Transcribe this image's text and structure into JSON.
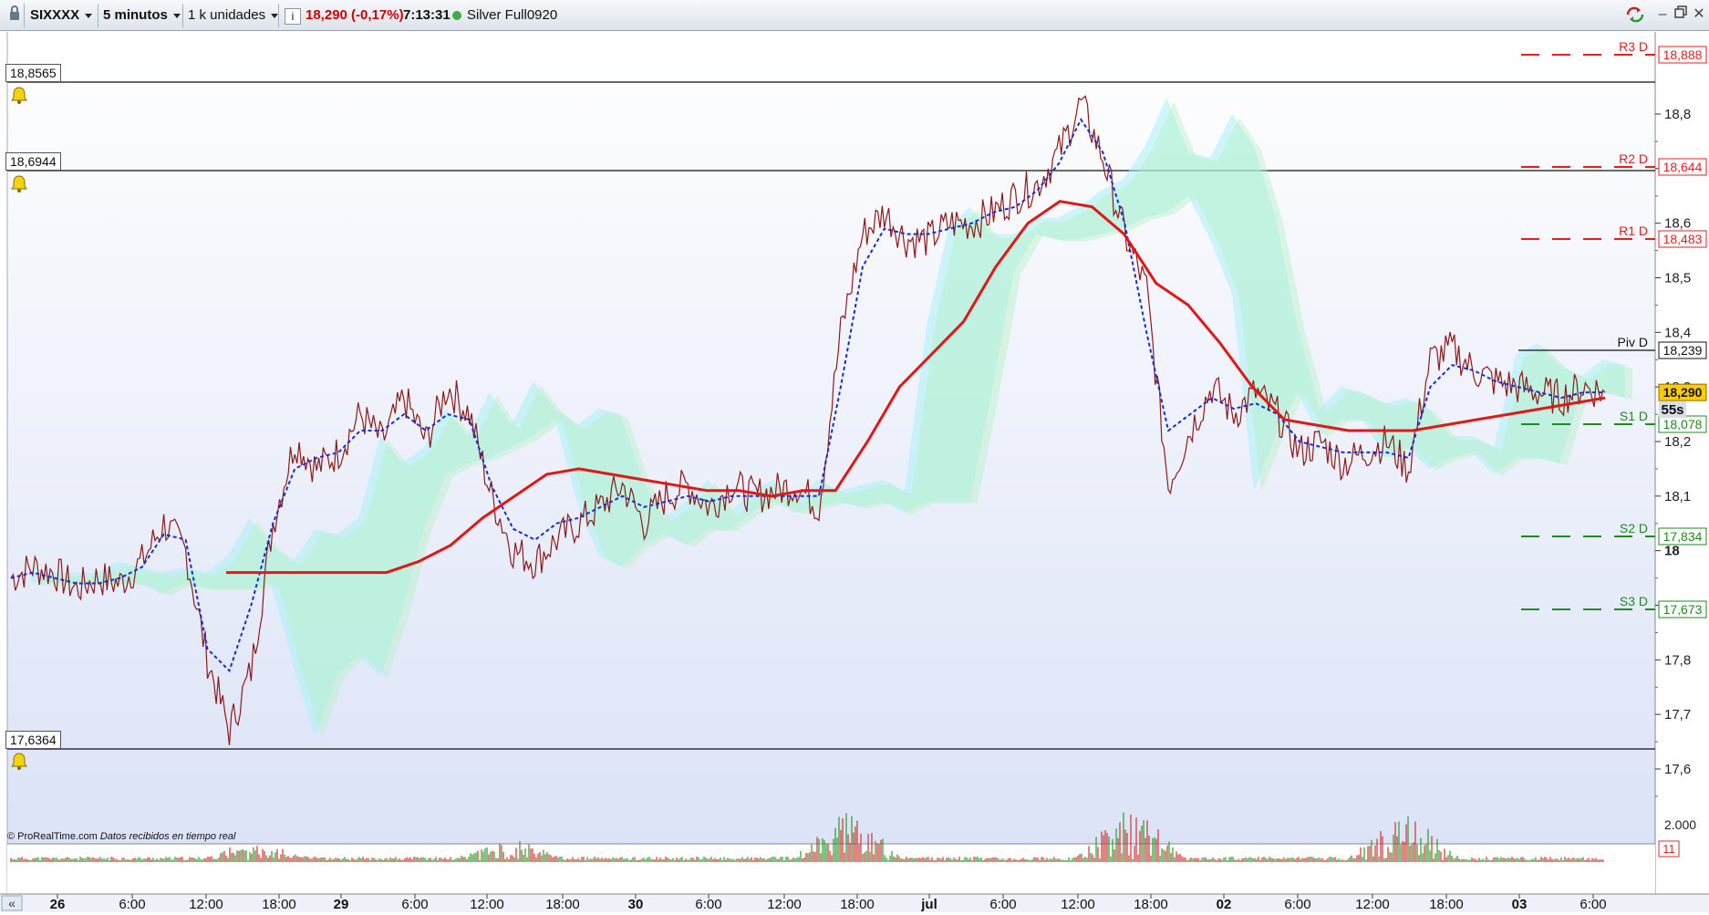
{
  "toolbar": {
    "symbol": "SIXXXX",
    "interval": "5 minutos",
    "units": "1 k unidades",
    "info_icon_label": "i",
    "price_change": "18,290 (-0,17%)",
    "time": "7:13:31",
    "feed": "Silver Full0920",
    "icons": [
      "lock-icon",
      "info-icon",
      "status-dot-icon",
      "refresh-icon",
      "minimize-icon",
      "restore-icon",
      "close-icon"
    ],
    "colors": {
      "price_change": "#cc0000",
      "status_dot": "#3cb043"
    }
  },
  "alert_levels": [
    {
      "label": "18,8565",
      "value": 18.8565
    },
    {
      "label": "18,6944",
      "value": 18.6944
    },
    {
      "label": "17,6364",
      "value": 17.6364
    }
  ],
  "pivots": [
    {
      "name": "R3 D",
      "value_label": "18,888",
      "value": 18.888,
      "color": "#e02020"
    },
    {
      "name": "R2 D",
      "value_label": "18,644",
      "value": 18.644,
      "color": "#e02020"
    },
    {
      "name": "R1 D",
      "value_label": "18,483",
      "value": 18.483,
      "color": "#e02020"
    },
    {
      "name": "Piv D",
      "value_label": "18,239",
      "value": 18.239,
      "color": "#111111"
    },
    {
      "name": "S1 D",
      "value_label": "18,078",
      "value": 18.078,
      "color": "#1f8a1f"
    },
    {
      "name": "S2 D",
      "value_label": "17,834",
      "value": 17.834,
      "color": "#1f8a1f"
    },
    {
      "name": "S3 D",
      "value_label": "17,673",
      "value": 17.673,
      "color": "#1f8a1f"
    }
  ],
  "current_price": {
    "label": "18,290",
    "value": 18.29,
    "countdown": "55s",
    "color": "#ffcc00"
  },
  "credit": {
    "brand": "© ProRealTime.com",
    "note": "Datos recibidos en tiempo real"
  },
  "volume_axis": {
    "label": "2.000",
    "current": "11"
  },
  "nav_button": "«",
  "chart_data": {
    "type": "line",
    "title": "",
    "ylim": [
      17.5,
      18.9
    ],
    "y_ticks": [
      "18,8",
      "18,7",
      "18,6",
      "18,5",
      "18,4",
      "18,3",
      "18,2",
      "18,1",
      "18",
      "17,9",
      "17,8",
      "17,7",
      "17,6"
    ],
    "y_tick_values": [
      18.8,
      18.7,
      18.6,
      18.5,
      18.4,
      18.3,
      18.2,
      18.1,
      18.0,
      17.9,
      17.8,
      17.7,
      17.6
    ],
    "x_ticks": [
      {
        "label": "26",
        "bold": true
      },
      {
        "label": "6:00"
      },
      {
        "label": "12:00"
      },
      {
        "label": "18:00"
      },
      {
        "label": "29",
        "bold": true
      },
      {
        "label": "6:00"
      },
      {
        "label": "12:00"
      },
      {
        "label": "18:00"
      },
      {
        "label": "30",
        "bold": true
      },
      {
        "label": "6:00"
      },
      {
        "label": "12:00"
      },
      {
        "label": "18:00"
      },
      {
        "label": "jul",
        "bold": true
      },
      {
        "label": "6:00"
      },
      {
        "label": "12:00"
      },
      {
        "label": "18:00"
      },
      {
        "label": "02",
        "bold": true
      },
      {
        "label": "6:00"
      },
      {
        "label": "12:00"
      },
      {
        "label": "18:00"
      },
      {
        "label": "03",
        "bold": true
      },
      {
        "label": "6:00"
      }
    ],
    "series": [
      {
        "kind": "price",
        "color": "#8b1a1a",
        "values": [
          17.95,
          17.97,
          17.96,
          17.93,
          17.95,
          17.94,
          17.98,
          18.05,
          18.0,
          17.8,
          17.67,
          17.78,
          18.05,
          18.2,
          18.15,
          18.18,
          18.25,
          18.2,
          18.28,
          18.2,
          18.3,
          18.25,
          18.1,
          18.0,
          17.98,
          18.02,
          18.05,
          18.08,
          18.12,
          18.05,
          18.1,
          18.12,
          18.08,
          18.12,
          18.1,
          18.11,
          18.12,
          18.08,
          18.4,
          18.58,
          18.62,
          18.57,
          18.57,
          18.6,
          18.6,
          18.62,
          18.65,
          18.67,
          18.73,
          18.82,
          18.72,
          18.58,
          18.48,
          18.12,
          18.22,
          18.3,
          18.25,
          18.29,
          18.25,
          18.18,
          18.2,
          18.16,
          18.18,
          18.2,
          18.15,
          18.35,
          18.37,
          18.33,
          18.31,
          18.3,
          18.29,
          18.28,
          18.3,
          18.29
        ]
      },
      {
        "kind": "tenkan",
        "color": "#1a2bd0",
        "values": [
          17.95,
          17.96,
          17.95,
          17.94,
          17.94,
          17.95,
          17.97,
          18.03,
          18.02,
          17.82,
          17.78,
          17.9,
          18.05,
          18.15,
          18.17,
          18.18,
          18.22,
          18.22,
          18.25,
          18.22,
          18.25,
          18.24,
          18.12,
          18.04,
          18.02,
          18.05,
          18.06,
          18.08,
          18.1,
          18.08,
          18.09,
          18.1,
          18.09,
          18.1,
          18.1,
          18.1,
          18.1,
          18.1,
          18.3,
          18.52,
          18.59,
          18.58,
          18.58,
          18.59,
          18.6,
          18.62,
          18.63,
          18.66,
          18.71,
          18.79,
          18.73,
          18.6,
          18.4,
          18.22,
          18.25,
          18.28,
          18.26,
          18.27,
          18.25,
          18.2,
          18.19,
          18.18,
          18.18,
          18.18,
          18.17,
          18.3,
          18.34,
          18.33,
          18.31,
          18.3,
          18.29,
          18.28,
          18.29,
          18.29
        ]
      },
      {
        "kind": "moving-average",
        "color": "#e01818",
        "values": [
          17.96,
          17.96,
          17.96,
          17.96,
          17.96,
          17.96,
          17.98,
          18.01,
          18.06,
          18.1,
          18.14,
          18.15,
          18.14,
          18.13,
          18.12,
          18.11,
          18.11,
          18.1,
          18.11,
          18.11,
          18.2,
          18.3,
          18.36,
          18.42,
          18.52,
          18.6,
          18.64,
          18.63,
          18.58,
          18.49,
          18.45,
          18.38,
          18.3,
          18.24,
          18.23,
          18.22,
          18.22,
          18.22,
          18.23,
          18.24,
          18.25,
          18.26,
          18.27,
          18.28
        ]
      }
    ],
    "volume": {
      "axis_max_label": "2.000",
      "last": "11"
    }
  }
}
